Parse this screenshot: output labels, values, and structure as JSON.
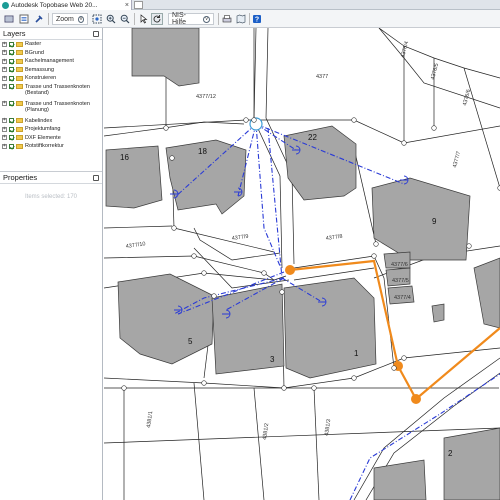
{
  "browser": {
    "tab_title": "Autodesk Topobase Web 20...",
    "close_glyph": "×"
  },
  "toolbar": {
    "zoom_label": "Zoom",
    "nis_label": "NIS-Hilfe",
    "icons": [
      "layers-icon",
      "list-icon",
      "tool-icon",
      "zoom-extent-icon",
      "zoom-in-icon",
      "zoom-out-icon",
      "pointer-icon",
      "refresh-icon",
      "print-icon",
      "map-icon",
      "help-icon"
    ]
  },
  "panels": {
    "layers_title": "Layers",
    "properties_title": "Properties",
    "items_selected": "Items selected: 170"
  },
  "layers": [
    {
      "label": "Raster"
    },
    {
      "label": "BGrund"
    },
    {
      "label": "Kachelmanagement"
    },
    {
      "label": "Bemassung"
    },
    {
      "label": "Konstruieren"
    },
    {
      "label": "Trasse und Trassenknoten (Bestand)"
    },
    {
      "label": "Trasse und Trassenknoten (Planung)"
    },
    {
      "label": "Kabelindex"
    },
    {
      "label": "Projektumfang"
    },
    {
      "label": "DXF Elemente"
    },
    {
      "label": "Rotstiftkorrektur"
    }
  ],
  "map": {
    "parcel_labels": [
      "4377",
      "4377/12",
      "4376/4",
      "4376/5",
      "4376/6",
      "4377/7",
      "4377/10",
      "4377/9",
      "4377/8",
      "4377/6",
      "4377/5",
      "4377/4",
      "4381/1",
      "4381/2",
      "4381/3"
    ],
    "house_numbers": [
      "16",
      "18",
      "22",
      "9",
      "5",
      "3",
      "1",
      "2"
    ],
    "colors": {
      "route": "#f08a1c",
      "cable": "#2a3bd6",
      "building": "#a6a6a6"
    }
  }
}
